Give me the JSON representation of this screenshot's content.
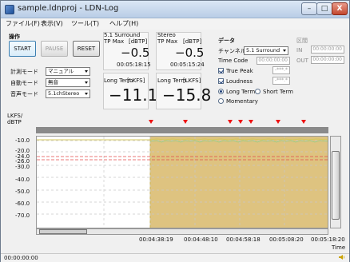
{
  "window": {
    "title": "sample.ldnproj - LDN-Log",
    "controls": {
      "minimize": "–",
      "maximize": "□",
      "close": "X"
    }
  },
  "menu": {
    "items": [
      "ファイル(F)",
      "表示(V)",
      "ツール(T)",
      "ヘルプ(H)"
    ]
  },
  "operation": {
    "title": "操作",
    "buttons": {
      "start": "START",
      "pause": "PAUSE",
      "reset": "RESET"
    }
  },
  "modes": {
    "measure": {
      "label": "計測モード",
      "value": "マニュアル"
    },
    "auto": {
      "label": "自動モード",
      "value": "無音"
    },
    "sound": {
      "label": "音声モード",
      "value": "5.1chStereo"
    }
  },
  "surround_51": {
    "title": "5.1 Surround",
    "tp_max_label": "TP Max",
    "unit": "[dBTP]",
    "tp_max_value": "−0.5",
    "tp_time": "00:05:18:15",
    "lt_label": "Long Term",
    "lt_unit": "[LKFS]",
    "lt_value": "−11.1"
  },
  "stereo": {
    "title": "Stereo",
    "tp_max_label": "TP Max",
    "unit": "[dBTP]",
    "tp_max_value": "−0.5",
    "tp_time": "00:05:15:24",
    "lt_label": "Long Term",
    "lt_unit": "[LKFS]",
    "lt_value": "−15.8"
  },
  "data_panel": {
    "title": "データ",
    "channel_label": "チャンネル",
    "channel_value": "5.1 Surround",
    "time_code_label": "Time Code",
    "time_code_value": "00:00:00:00",
    "true_peak_label": "True Peak",
    "true_peak_checked": true,
    "true_peak_value": "-***.*",
    "loudness_label": "Loudness",
    "loudness_checked": true,
    "loudness_value": "-***.*",
    "long_term_label": "Long Term",
    "short_term_label": "Short Term",
    "momentary_label": "Momentary",
    "selected_term": "Long Term"
  },
  "range_panel": {
    "title": "区間",
    "in_label": "IN",
    "in_value": "00:00:00:00",
    "out_label": "OUT",
    "out_value": "00:00:00:00"
  },
  "graph": {
    "yaxis_title_line1": "LKFS/",
    "yaxis_title_line2": "dBTP",
    "yticks": [
      "-10.0",
      "-20.0",
      "-24.0",
      "-26.0",
      "-30.0",
      "-40.0",
      "-50.0",
      "-60.0",
      "-70.0"
    ],
    "xticks": [
      "00:04:38:19",
      "00:04:48:10",
      "00:04:58:18",
      "00:05:08:20",
      "00:05:18:20"
    ],
    "xlabel": "Time",
    "colors": {
      "background": "#ffffff",
      "active_region": "#d8b86a",
      "active_region_border": "#cbb14e",
      "line_yellow": "#d6c85a",
      "line_green": "#8fcf86",
      "line_red_dashed": "#e44b4b",
      "marker": "#e11111"
    }
  },
  "status": {
    "time": "00:00:00:00"
  }
}
